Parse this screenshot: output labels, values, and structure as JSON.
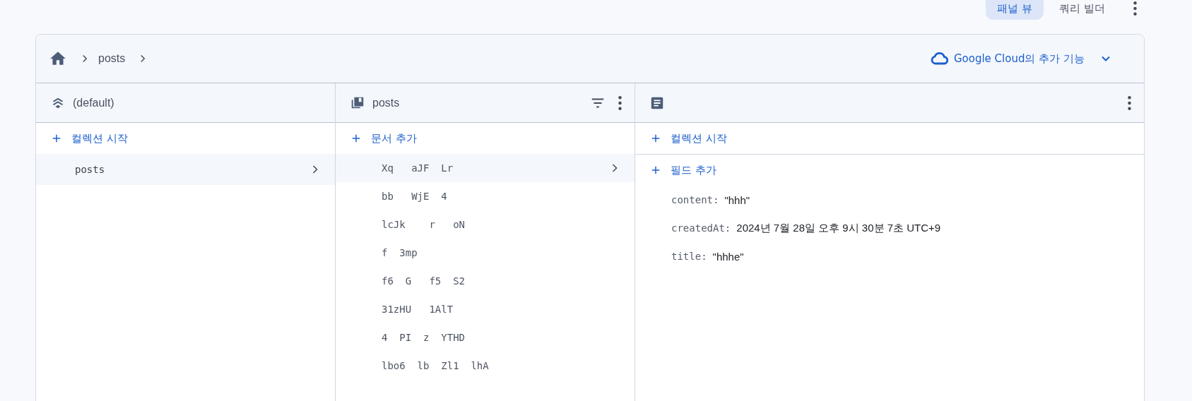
{
  "toolbar": {
    "view_toggle": [
      {
        "label": "패널 뷰",
        "selected": true
      },
      {
        "label": "쿼리 빌더",
        "selected": false
      }
    ]
  },
  "breadcrumb": [
    "posts"
  ],
  "extensions_button": "Google Cloud의 추가 기능",
  "panels": [
    {
      "kind": "database",
      "title": "(default)",
      "action": "컬렉션 시작",
      "items": [
        {
          "label": "posts",
          "selected": true
        }
      ]
    },
    {
      "kind": "collection",
      "title": "posts",
      "action": "문서 추가",
      "items": [
        {
          "label": "Xq   aJF  Lr",
          "selected": true
        },
        {
          "label": "bb   WjE  4",
          "selected": false
        },
        {
          "label": "lcJk    r   oN",
          "selected": false
        },
        {
          "label": "f  3mp",
          "selected": false
        },
        {
          "label": "f6  G   f5  S2",
          "selected": false
        },
        {
          "label": "31zHU   1AlT",
          "selected": false
        },
        {
          "label": "4  PI  z  YTHD",
          "selected": false
        },
        {
          "label": "lbo6  lb  Zl1  lhA",
          "selected": false
        }
      ]
    },
    {
      "kind": "document",
      "action": "컬렉션 시작",
      "field_action": "필드 추가",
      "fields": [
        {
          "key": "content:",
          "value": "\"hhh\""
        },
        {
          "key": "createdAt:",
          "value": "2024년 7월 28일 오후 9시 30분 7초 UTC+9"
        },
        {
          "key": "title:",
          "value": "\"hhhe\""
        }
      ]
    }
  ]
}
